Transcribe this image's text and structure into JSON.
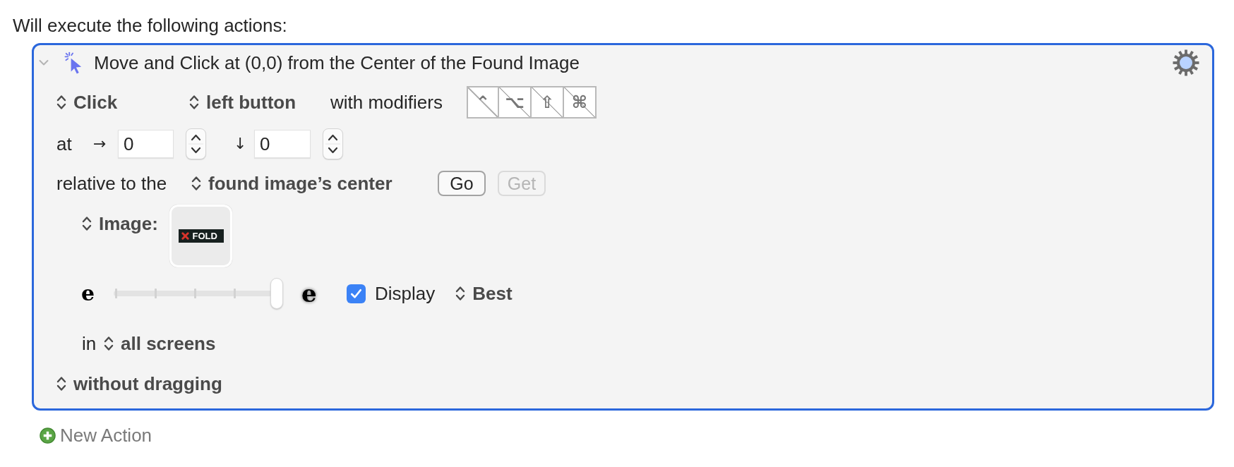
{
  "heading": "Will execute the following actions:",
  "action": {
    "expanded": true,
    "title": "Move and Click at (0,0) from the Center of the Found Image",
    "click_row": {
      "click_type": "Click",
      "button": "left button",
      "modifiers_label": "with modifiers",
      "modifiers": [
        {
          "symbol": "⌃",
          "on": false
        },
        {
          "symbol": "⌥",
          "on": false
        },
        {
          "symbol": "⇧",
          "on": false
        },
        {
          "symbol": "⌘",
          "on": false
        }
      ]
    },
    "position_row": {
      "label": "at",
      "x_arrow": "→",
      "x_value": "0",
      "y_arrow": "↓",
      "y_value": "0"
    },
    "relative_row": {
      "label": "relative to the",
      "anchor": "found image’s center",
      "buttons": [
        {
          "label": "Go",
          "disabled": false
        },
        {
          "label": "Get",
          "disabled": true
        }
      ]
    },
    "image_row": {
      "label": "Image:",
      "thumbnail_text": "FOLD"
    },
    "fuzziness": {
      "min_label": "e",
      "level": 1,
      "max_label": "e",
      "display": {
        "label": "Display",
        "checked": true
      },
      "mode": "Best"
    },
    "screen_row": {
      "label": "in",
      "screens": "all screens"
    },
    "drag": "without dragging"
  },
  "new_action": "New Action"
}
